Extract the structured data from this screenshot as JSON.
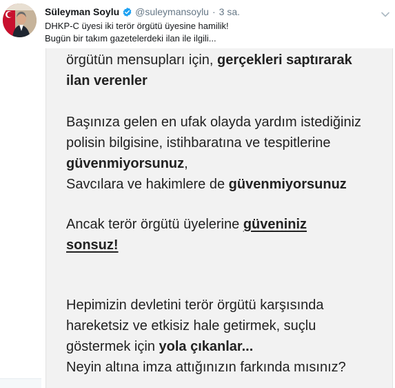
{
  "user": {
    "name": "Süleyman Soylu",
    "handle": "@suleymansoylu",
    "separator": "·",
    "time": "3 sa."
  },
  "icons": {
    "verified": "verified-badge-icon",
    "caret": "chevron-down-icon",
    "avatar": "user-avatar"
  },
  "tweet": {
    "line1": "DHKP-C üyesi iki terör örgütü üyesine hamilik!",
    "line2": "Bugün bir takım gazetelerdeki ilan ile ilgili..."
  },
  "image_text": {
    "p1_a": "örgütün mensupları için, ",
    "p1_b": "gerçekleri saptırarak",
    "p1_c": "ilan verenler",
    "p2_l1": "Başınıza gelen en ufak olayda yardım istediğiniz",
    "p2_l2": "polisin bilgisine, istihbaratına ve tespitlerine",
    "p2_l3a": "güvenmiyorsunuz",
    "p2_l3b": ",",
    "p2_l4a": "Savcılara ve hakimlere de ",
    "p2_l4b": "güvenmiyorsunuz",
    "p3_l1a": "Ancak terör örgütü üyelerine ",
    "p3_l1b": "güveniniz",
    "p3_l2": "sonsuz!",
    "p4_l1": "Hepimizin devletini terör örgütü karşısında",
    "p4_l2": "hareketsiz ve etkisiz hale getirmek, suçlu",
    "p4_l3a": "göstermek için ",
    "p4_l3b": "yola çıkanlar...",
    "p4_l4": "Neyin altına imza attığınızın farkında mısınız?"
  },
  "colors": {
    "link_gray": "#657786",
    "verified_blue": "#1da1f2",
    "image_bg": "#f2f2f2"
  }
}
